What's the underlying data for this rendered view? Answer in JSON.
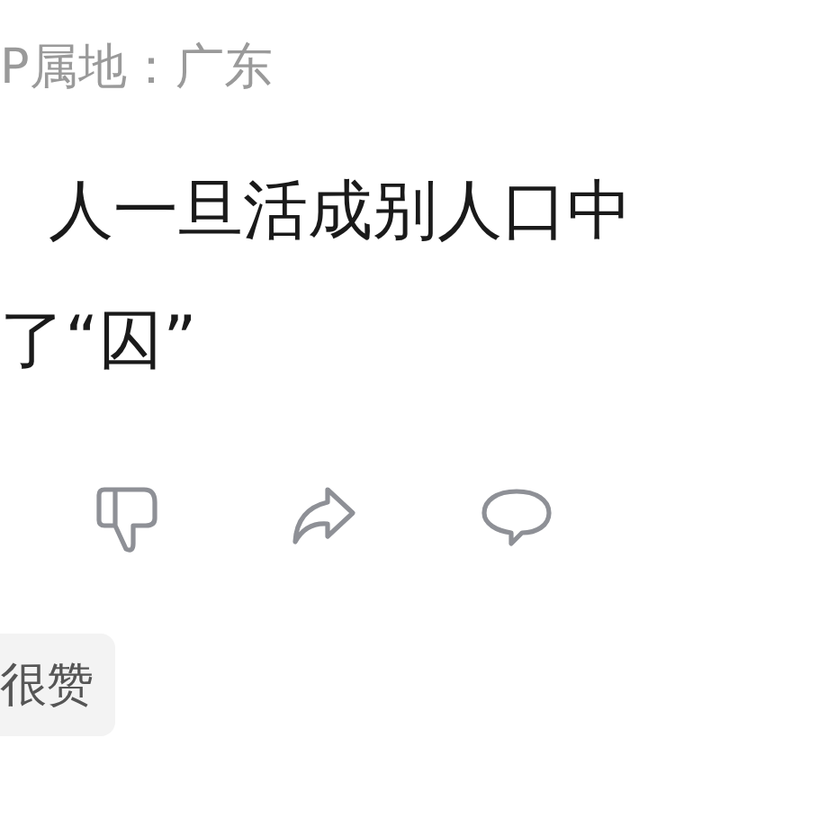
{
  "location": "P属地：广东",
  "content_lines": [
    "人一旦活成别人口中",
    "了“囚”"
  ],
  "actions": [
    {
      "kind": "dislike"
    },
    {
      "kind": "share"
    },
    {
      "kind": "comment"
    }
  ],
  "tag": "很赞"
}
